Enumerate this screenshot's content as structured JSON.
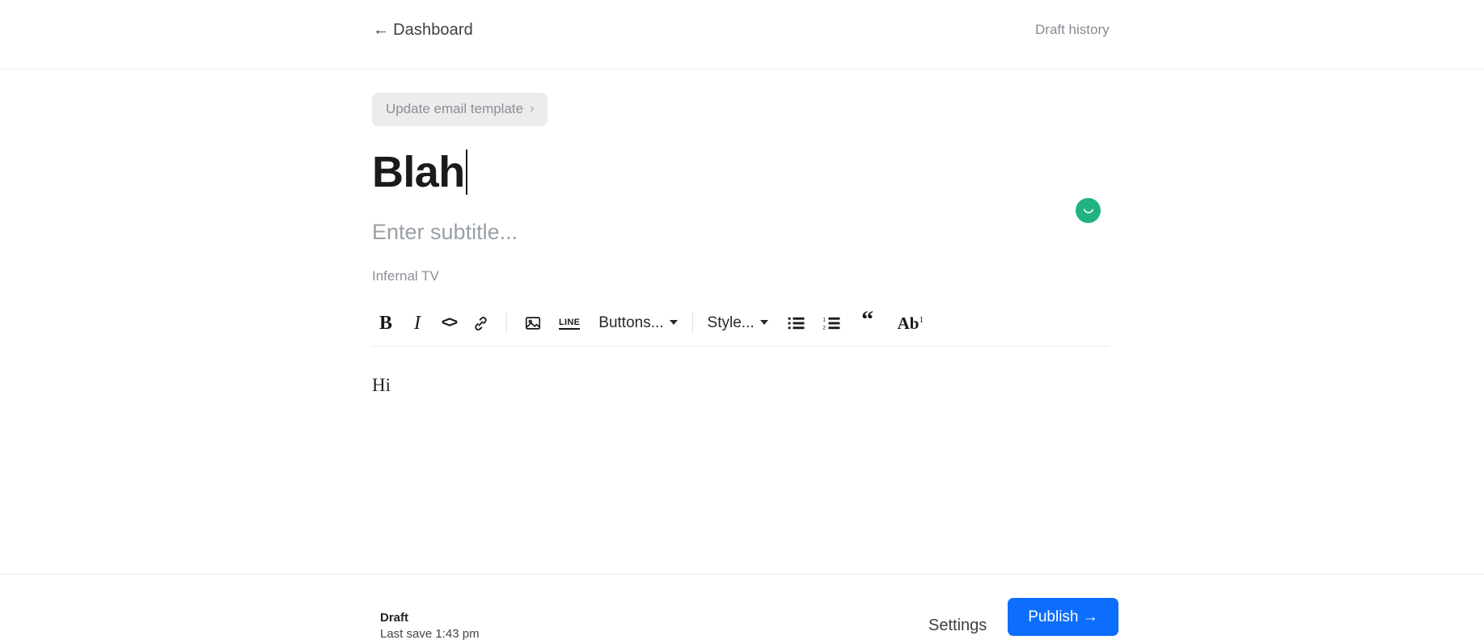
{
  "header": {
    "back_arrow": "←",
    "back_label": "Dashboard",
    "history_label": "Draft history"
  },
  "editor": {
    "template_pill": {
      "label": "Update email template",
      "chevron": "›"
    },
    "title": "Blah",
    "subtitle_placeholder": "Enter subtitle...",
    "byline": "Infernal TV",
    "body_text": "Hi"
  },
  "toolbar": {
    "bold": "B",
    "italic": "I",
    "code": "<>",
    "link_icon": "link-icon",
    "image_icon": "image-icon",
    "line_label": "LINE",
    "buttons_dropdown": "Buttons...",
    "style_dropdown": "Style...",
    "bullet_list_icon": "bullet-list-icon",
    "numbered_list_icon": "numbered-list-icon",
    "blockquote": "“",
    "footnote_main": "Ab",
    "footnote_sup": "1"
  },
  "status_indicator": {
    "name": "saving-spinner",
    "color": "#21b284"
  },
  "footer": {
    "draft_status": "Draft",
    "last_save": "Last save 1:43 pm",
    "settings_label": "Settings",
    "publish_label": "Publish →",
    "publish_color": "#0d6efd"
  }
}
